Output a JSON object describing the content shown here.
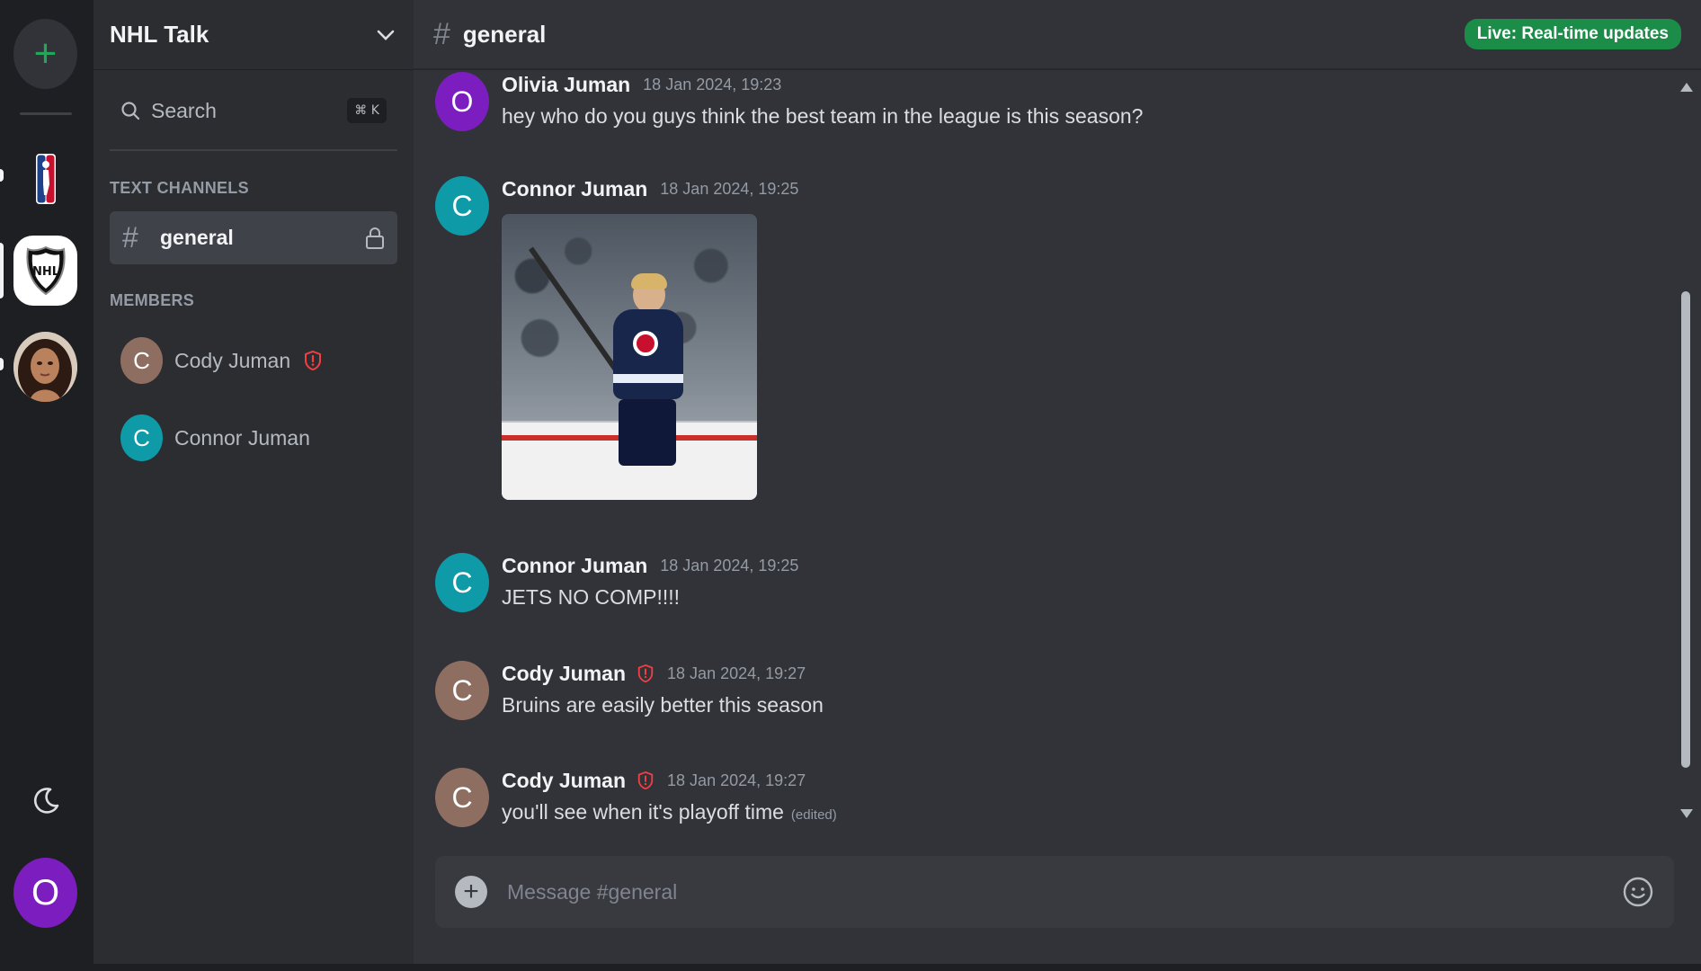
{
  "colors": {
    "accent_green": "#23a55a",
    "live_badge": "#1b8d48",
    "mod_shield": "#f23f43",
    "avatar_purple": "#7c1dbf",
    "avatar_teal": "#0e9aa7",
    "avatar_brown": "#8f6e62"
  },
  "rail": {
    "add_server_icon": "plus-icon",
    "servers": [
      {
        "name": "NBA",
        "icon": "nba-logo"
      },
      {
        "name": "NHL",
        "icon": "nhl-shield-logo",
        "selected": true
      },
      {
        "name": "Profile server",
        "icon": "person-photo"
      }
    ],
    "theme_icon": "moon-icon",
    "user_initial": "O"
  },
  "sidebar": {
    "server_name": "NHL Talk",
    "search_label": "Search",
    "search_shortcut": "⌘ K",
    "text_channels_label": "TEXT CHANNELS",
    "channels": [
      {
        "name": "general",
        "locked": true,
        "selected": true
      }
    ],
    "members_label": "MEMBERS",
    "members": [
      {
        "initial": "C",
        "name": "Cody Juman",
        "moderator": true,
        "color": "#8f6e62"
      },
      {
        "initial": "C",
        "name": "Connor Juman",
        "moderator": false,
        "color": "#0e9aa7"
      }
    ]
  },
  "header": {
    "channel": "general",
    "live_badge": "Live: Real-time updates"
  },
  "messages": [
    {
      "initial": "O",
      "author": "Olivia Juman",
      "time": "18 Jan 2024, 19:23",
      "text": "hey who do you guys think the best team in the league is this season?",
      "moderator": false
    },
    {
      "initial": "C",
      "author": "Connor Juman",
      "time": "18 Jan 2024, 19:25",
      "attachment": "hockey-player-celebration-photo",
      "moderator": false
    },
    {
      "initial": "C",
      "author": "Connor Juman",
      "time": "18 Jan 2024, 19:25",
      "text": "JETS NO COMP!!!!",
      "moderator": false
    },
    {
      "initial": "C",
      "author": "Cody Juman",
      "time": "18 Jan 2024, 19:27",
      "text": "Bruins are easily better this season",
      "moderator": true
    },
    {
      "initial": "C",
      "author": "Cody Juman",
      "time": "18 Jan 2024, 19:27",
      "text": "you'll see when it's playoff time",
      "edited": "(edited)",
      "moderator": true
    }
  ],
  "composer": {
    "placeholder": "Message #general",
    "add_icon": "plus-circle-icon",
    "emoji_icon": "smiley-icon"
  }
}
